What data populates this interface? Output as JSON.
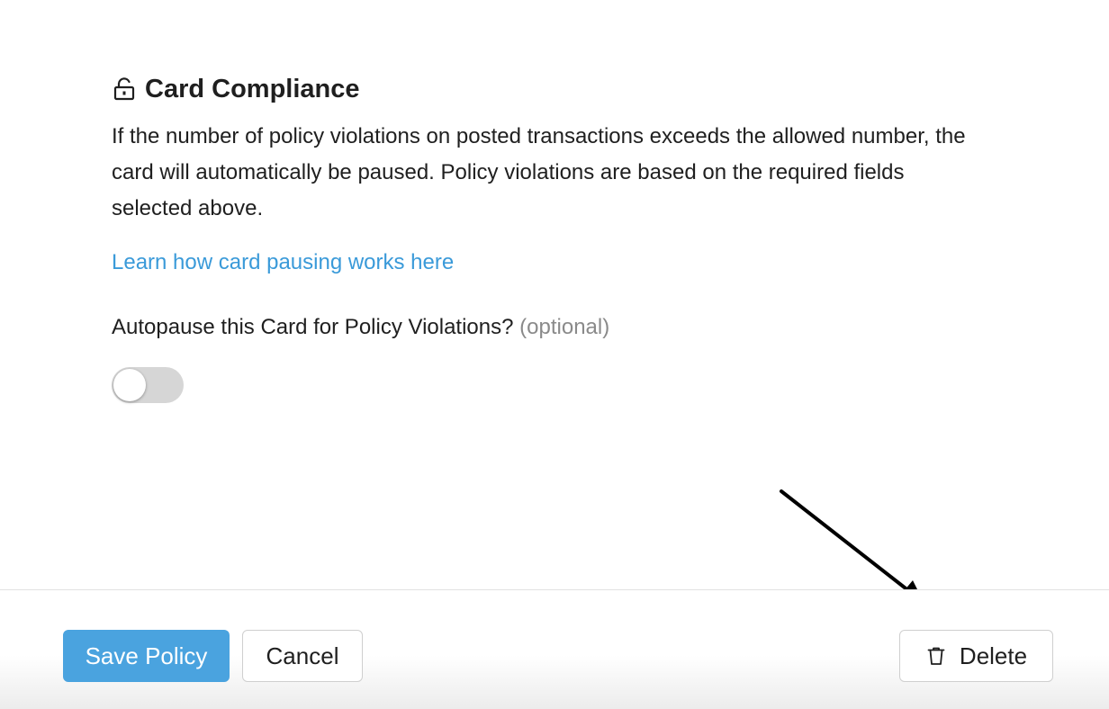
{
  "policy": {
    "section_title": "Card Compliance",
    "section_icon": "unlocked-lock-icon",
    "description": "If the number of policy violations on posted transactions exceeds the allowed number, the card will automatically be paused. Policy violations are based on the required fields selected above.",
    "learn_link": "Learn how card pausing works here",
    "autopause_question": "Autopause this Card for Policy Violations?",
    "optional_label": "(optional)",
    "autopause_enabled": false
  },
  "footer": {
    "save_label": "Save Policy",
    "cancel_label": "Cancel",
    "delete_label": "Delete",
    "delete_icon": "trash-icon"
  },
  "colors": {
    "link": "#3a9ad9",
    "primary_button": "#4aa3df",
    "toggle_off": "#d6d6d6"
  }
}
